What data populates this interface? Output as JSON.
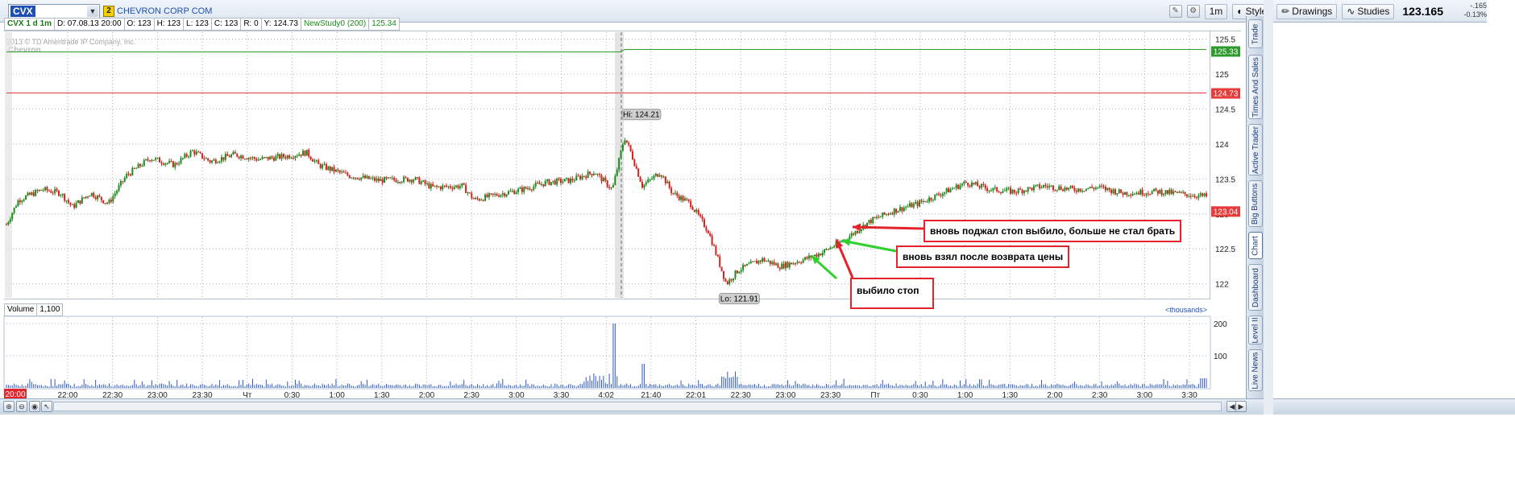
{
  "toolbar": {
    "symbol": "CVX",
    "link_badge": "2",
    "company": "CHEVRON CORP COM",
    "timeframe_button": "1m",
    "style_label": "Style",
    "drawings_label": "Drawings",
    "studies_label": "Studies",
    "last_price": "123.165",
    "change": "-.165",
    "change_pct": "-0.13%"
  },
  "infobar": {
    "symbol_period": "CVX 1 d 1m",
    "date": "D: 07.08.13 20:00",
    "open": "O: 123",
    "high": "H: 123",
    "low": "L: 123",
    "close": "C: 123",
    "range": "R: 0",
    "y": "Y: 124.73",
    "study": "NewStudy0 (200)",
    "study_value": "125.34"
  },
  "watermark": {
    "copyright": "2013 © TD Ameritrade IP Company, Inc.",
    "brand": "Chevron"
  },
  "volume_pane": {
    "label": "Volume",
    "value": "1,100",
    "unit": "<thousands>",
    "ticks": [
      "200",
      "100"
    ]
  },
  "colors": {
    "up": "#1e8a1e",
    "down": "#d0231e",
    "study": "#2e9a2e",
    "ref_line": "#e53b3b",
    "grid": "#8aa0bb"
  },
  "chart_data": {
    "type": "candlestick",
    "price_ticks": [
      "125.5",
      "125",
      "124.5",
      "124",
      "123.5",
      "123",
      "122.5",
      "122"
    ],
    "ylim": [
      121.8,
      125.6
    ],
    "time_labels": [
      "22:00",
      "22:30",
      "23:00",
      "23:30",
      "Чт",
      "0:30",
      "1:00",
      "1:30",
      "2:00",
      "2:30",
      "3:00",
      "3:30",
      "4:02",
      "21:40",
      "22:01",
      "22:30",
      "23:00",
      "23:30",
      "Пт",
      "0:30",
      "1:00",
      "1:30",
      "2:00",
      "2:30",
      "3:00",
      "3:30"
    ],
    "current_time_label": "20:00",
    "close_series": [
      {
        "t": 0,
        "v": 122.85
      },
      {
        "t": 0.01,
        "v": 123.2
      },
      {
        "t": 0.03,
        "v": 123.35
      },
      {
        "t": 0.045,
        "v": 123.3
      },
      {
        "t": 0.055,
        "v": 123.1
      },
      {
        "t": 0.07,
        "v": 123.3
      },
      {
        "t": 0.085,
        "v": 123.15
      },
      {
        "t": 0.1,
        "v": 123.55
      },
      {
        "t": 0.12,
        "v": 123.8
      },
      {
        "t": 0.14,
        "v": 123.7
      },
      {
        "t": 0.155,
        "v": 123.9
      },
      {
        "t": 0.17,
        "v": 123.75
      },
      {
        "t": 0.19,
        "v": 123.85
      },
      {
        "t": 0.21,
        "v": 123.78
      },
      {
        "t": 0.235,
        "v": 123.83
      },
      {
        "t": 0.25,
        "v": 123.88
      },
      {
        "t": 0.26,
        "v": 123.7
      },
      {
        "t": 0.285,
        "v": 123.55
      },
      {
        "t": 0.31,
        "v": 123.48
      },
      {
        "t": 0.34,
        "v": 123.5
      },
      {
        "t": 0.355,
        "v": 123.38
      },
      {
        "t": 0.38,
        "v": 123.4
      },
      {
        "t": 0.39,
        "v": 123.2
      },
      {
        "t": 0.41,
        "v": 123.28
      },
      {
        "t": 0.43,
        "v": 123.35
      },
      {
        "t": 0.45,
        "v": 123.45
      },
      {
        "t": 0.47,
        "v": 123.48
      },
      {
        "t": 0.49,
        "v": 123.6
      },
      {
        "t": 0.505,
        "v": 123.35
      },
      {
        "t": 0.515,
        "v": 124.1
      },
      {
        "t": 0.52,
        "v": 123.9
      },
      {
        "t": 0.53,
        "v": 123.4
      },
      {
        "t": 0.545,
        "v": 123.6
      },
      {
        "t": 0.555,
        "v": 123.3
      },
      {
        "t": 0.57,
        "v": 123.15
      },
      {
        "t": 0.585,
        "v": 122.75
      },
      {
        "t": 0.6,
        "v": 122.0
      },
      {
        "t": 0.61,
        "v": 122.2
      },
      {
        "t": 0.63,
        "v": 122.35
      },
      {
        "t": 0.645,
        "v": 122.25
      },
      {
        "t": 0.665,
        "v": 122.35
      },
      {
        "t": 0.68,
        "v": 122.45
      },
      {
        "t": 0.7,
        "v": 122.65
      },
      {
        "t": 0.72,
        "v": 122.9
      },
      {
        "t": 0.74,
        "v": 123.05
      },
      {
        "t": 0.76,
        "v": 123.15
      },
      {
        "t": 0.78,
        "v": 123.3
      },
      {
        "t": 0.8,
        "v": 123.45
      },
      {
        "t": 0.82,
        "v": 123.35
      },
      {
        "t": 0.84,
        "v": 123.32
      },
      {
        "t": 0.865,
        "v": 123.4
      },
      {
        "t": 0.89,
        "v": 123.35
      },
      {
        "t": 0.91,
        "v": 123.38
      },
      {
        "t": 0.93,
        "v": 123.3
      },
      {
        "t": 0.96,
        "v": 123.32
      },
      {
        "t": 1.0,
        "v": 123.25
      }
    ],
    "study_line": 125.33,
    "ref_line": 124.73,
    "current_price": 123.04,
    "high_label": "Hi: 124.21",
    "low_label": "Lo: 121.91",
    "axis_badges": [
      "125.33",
      "124.73",
      "123.04"
    ]
  },
  "annotations": [
    {
      "text": "вновь поджал стоп выбило, больше не стал брать"
    },
    {
      "text": "вновь взял после возврата цены"
    },
    {
      "text": "выбило стоп"
    }
  ],
  "sidebar": {
    "tabs": [
      "Trade",
      "Times And Sales",
      "Active Trader",
      "Big Buttons",
      "Chart",
      "Dashboard",
      "Level II",
      "Live News"
    ],
    "active": "Chart"
  }
}
